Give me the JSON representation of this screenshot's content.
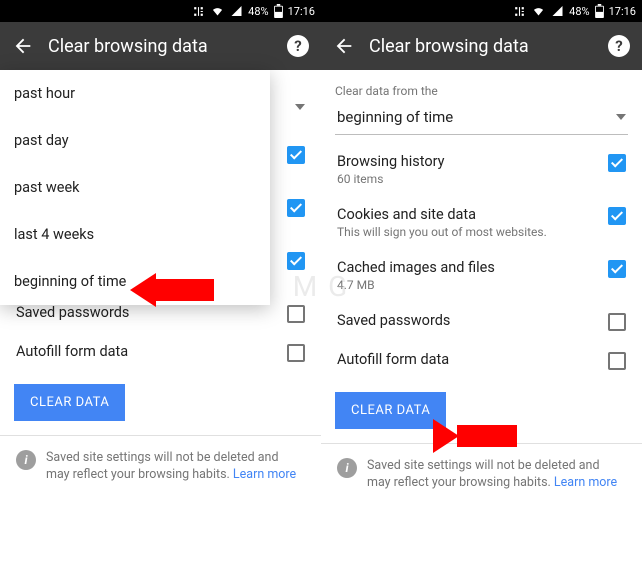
{
  "status": {
    "battery": "48%",
    "time": "17:16"
  },
  "appbar": {
    "title": "Clear browsing data"
  },
  "label": "Clear data from the",
  "dropdown": {
    "options": [
      "past hour",
      "past day",
      "past week",
      "last 4 weeks",
      "beginning of time"
    ]
  },
  "selected": "beginning of time",
  "items": {
    "browsing": {
      "title": "Browsing history",
      "sub": "60 items"
    },
    "cookies": {
      "title": "Cookies and site data",
      "sub": "This will sign you out of most websites."
    },
    "cache": {
      "title": "Cached images and files",
      "sub": "4.7 MB"
    },
    "passwords": {
      "title": "Saved passwords"
    },
    "autofill": {
      "title": "Autofill form data"
    }
  },
  "button": "CLEAR DATA",
  "footer": {
    "text": "Saved site settings will not be deleted and may reflect your browsing habits. ",
    "link": "Learn more"
  },
  "watermark": "M   G"
}
